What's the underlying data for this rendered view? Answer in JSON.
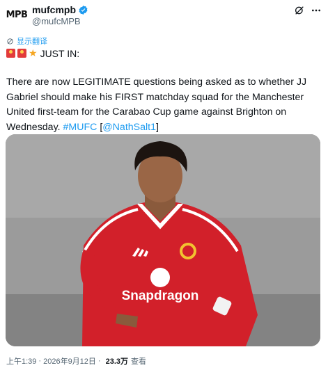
{
  "author": {
    "avatar_text": "MPB",
    "display_name": "mufcmpb",
    "handle": "@mufcMPB",
    "verified": true
  },
  "actions": {
    "grok_icon": "grok-icon",
    "more_icon": "more-icon"
  },
  "translate_label": "显示翻译",
  "tweet": {
    "headline": "JUST IN:",
    "body_plain": "There are now LEGITIMATE questions being asked as to whether JJ Gabriel should make his FIRST matchday squad for the Manchester United first-team for the Carabao Cup game against Brighton on Wednesday. ",
    "hashtag": "#MUFC",
    "mention_open": "[",
    "mention": "@NathSalt1",
    "mention_close": "]"
  },
  "media": {
    "alt": "Player in red Manchester United kit",
    "sponsor": "Snapdragon"
  },
  "footer": {
    "time": "上午1:39",
    "sep1": "·",
    "date": "2026年9月12日",
    "sep2": "·",
    "views": "23.3万",
    "views_label": "查看"
  },
  "colors": {
    "link": "#1d9bf0",
    "text": "#0f1419",
    "muted": "#536471",
    "kit_red": "#d2202a"
  }
}
